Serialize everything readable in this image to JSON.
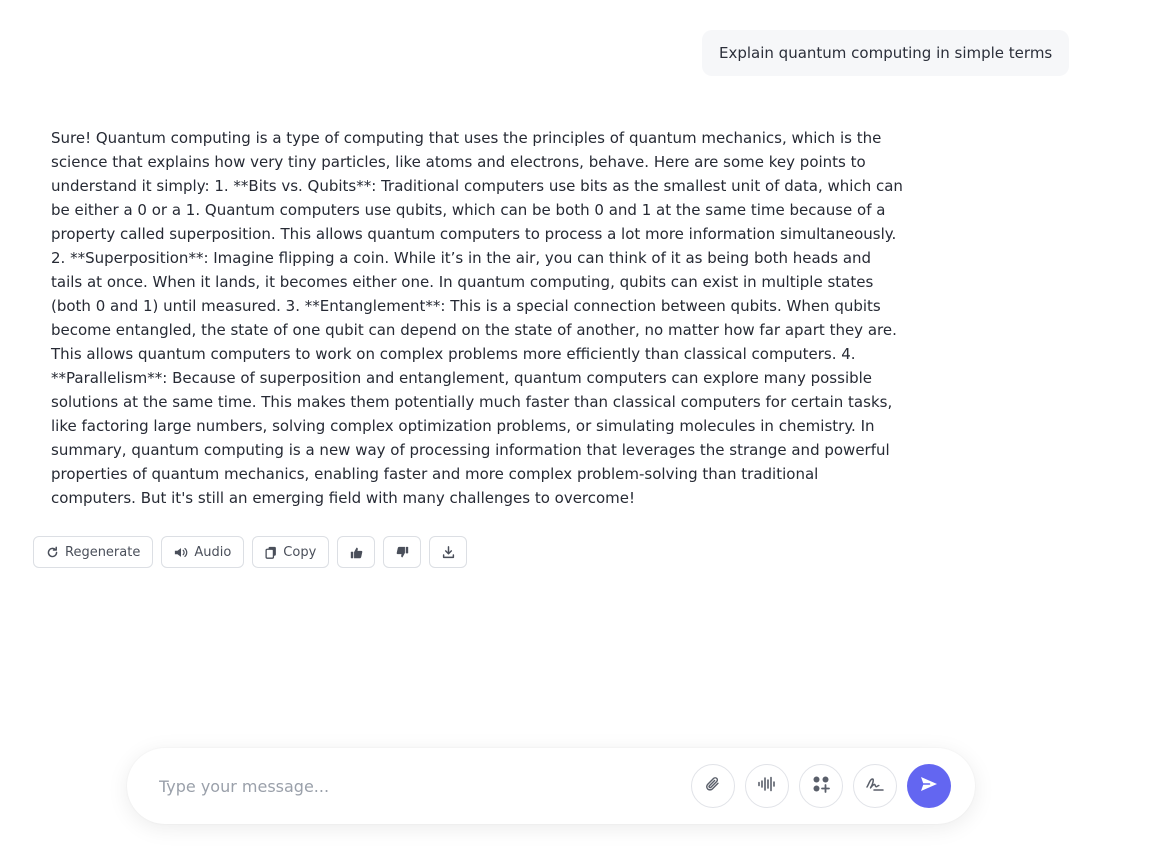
{
  "conversation": {
    "user_message": "Explain quantum computing in simple terms",
    "assistant_message": "Sure! Quantum computing is a type of computing that uses the principles of quantum mechanics, which is the science that explains how very tiny particles, like atoms and electrons, behave. Here are some key points to understand it simply: 1. **Bits vs. Qubits**: Traditional computers use bits as the smallest unit of data, which can be either a 0 or a 1. Quantum computers use qubits, which can be both 0 and 1 at the same time because of a property called superposition. This allows quantum computers to process a lot more information simultaneously. 2. **Superposition**: Imagine flipping a coin. While it’s in the air, you can think of it as being both heads and tails at once. When it lands, it becomes either one. In quantum computing, qubits can exist in multiple states (both 0 and 1) until measured. 3. **Entanglement**: This is a special connection between qubits. When qubits become entangled, the state of one qubit can depend on the state of another, no matter how far apart they are. This allows quantum computers to work on complex problems more efficiently than classical computers. 4. **Parallelism**: Because of superposition and entanglement, quantum computers can explore many possible solutions at the same time. This makes them potentially much faster than classical computers for certain tasks, like factoring large numbers, solving complex optimization problems, or simulating molecules in chemistry. In summary, quantum computing is a new way of processing information that leverages the strange and powerful properties of quantum mechanics, enabling faster and more complex problem-solving than traditional computers. But it's still an emerging field with many challenges to overcome!"
  },
  "actions": {
    "regenerate_label": "Regenerate",
    "audio_label": "Audio",
    "copy_label": "Copy",
    "icons": [
      "refresh-icon",
      "speaker-icon",
      "copy-icon",
      "thumbs-up-icon",
      "thumbs-down-icon",
      "download-icon"
    ]
  },
  "composer": {
    "placeholder": "Type your message...",
    "value": "",
    "icons": [
      "paperclip-icon",
      "waveform-icon",
      "apps-plus-icon",
      "signature-icon",
      "send-icon"
    ]
  },
  "colors": {
    "accent": "#6366f1",
    "user_bubble_bg": "#f6f7f9",
    "text": "#262a34",
    "muted": "#9aa0aa"
  }
}
